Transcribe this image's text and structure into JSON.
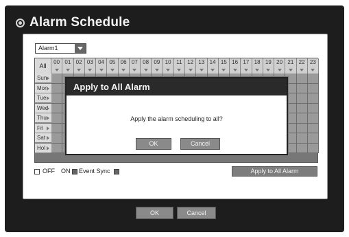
{
  "window": {
    "title": "Alarm Schedule"
  },
  "alarm_select": {
    "value": "Alarm1"
  },
  "schedule": {
    "all_label": "All",
    "hours": [
      "00",
      "01",
      "02",
      "03",
      "04",
      "05",
      "06",
      "07",
      "08",
      "09",
      "10",
      "11",
      "12",
      "13",
      "14",
      "15",
      "16",
      "17",
      "18",
      "19",
      "20",
      "21",
      "22",
      "23"
    ],
    "days": [
      "Sun",
      "Mon",
      "Tue",
      "Wed",
      "Thu",
      "Fri",
      "Sat",
      "Hol"
    ]
  },
  "legend": {
    "off": "OFF",
    "on": "ON",
    "event_sync": "Event Sync"
  },
  "apply_to_all_button": "Apply to All Alarm",
  "footer": {
    "ok": "OK",
    "cancel": "Cancel"
  },
  "dialog": {
    "title": "Apply to All Alarm",
    "message": "Apply the alarm scheduling to all?",
    "ok": "OK",
    "cancel": "Cancel"
  },
  "colors": {
    "frame": "#1d1d1d",
    "cell_on": "#9a9a9a",
    "header_bg": "#cfcfcf",
    "button": "#8a8a8a"
  }
}
